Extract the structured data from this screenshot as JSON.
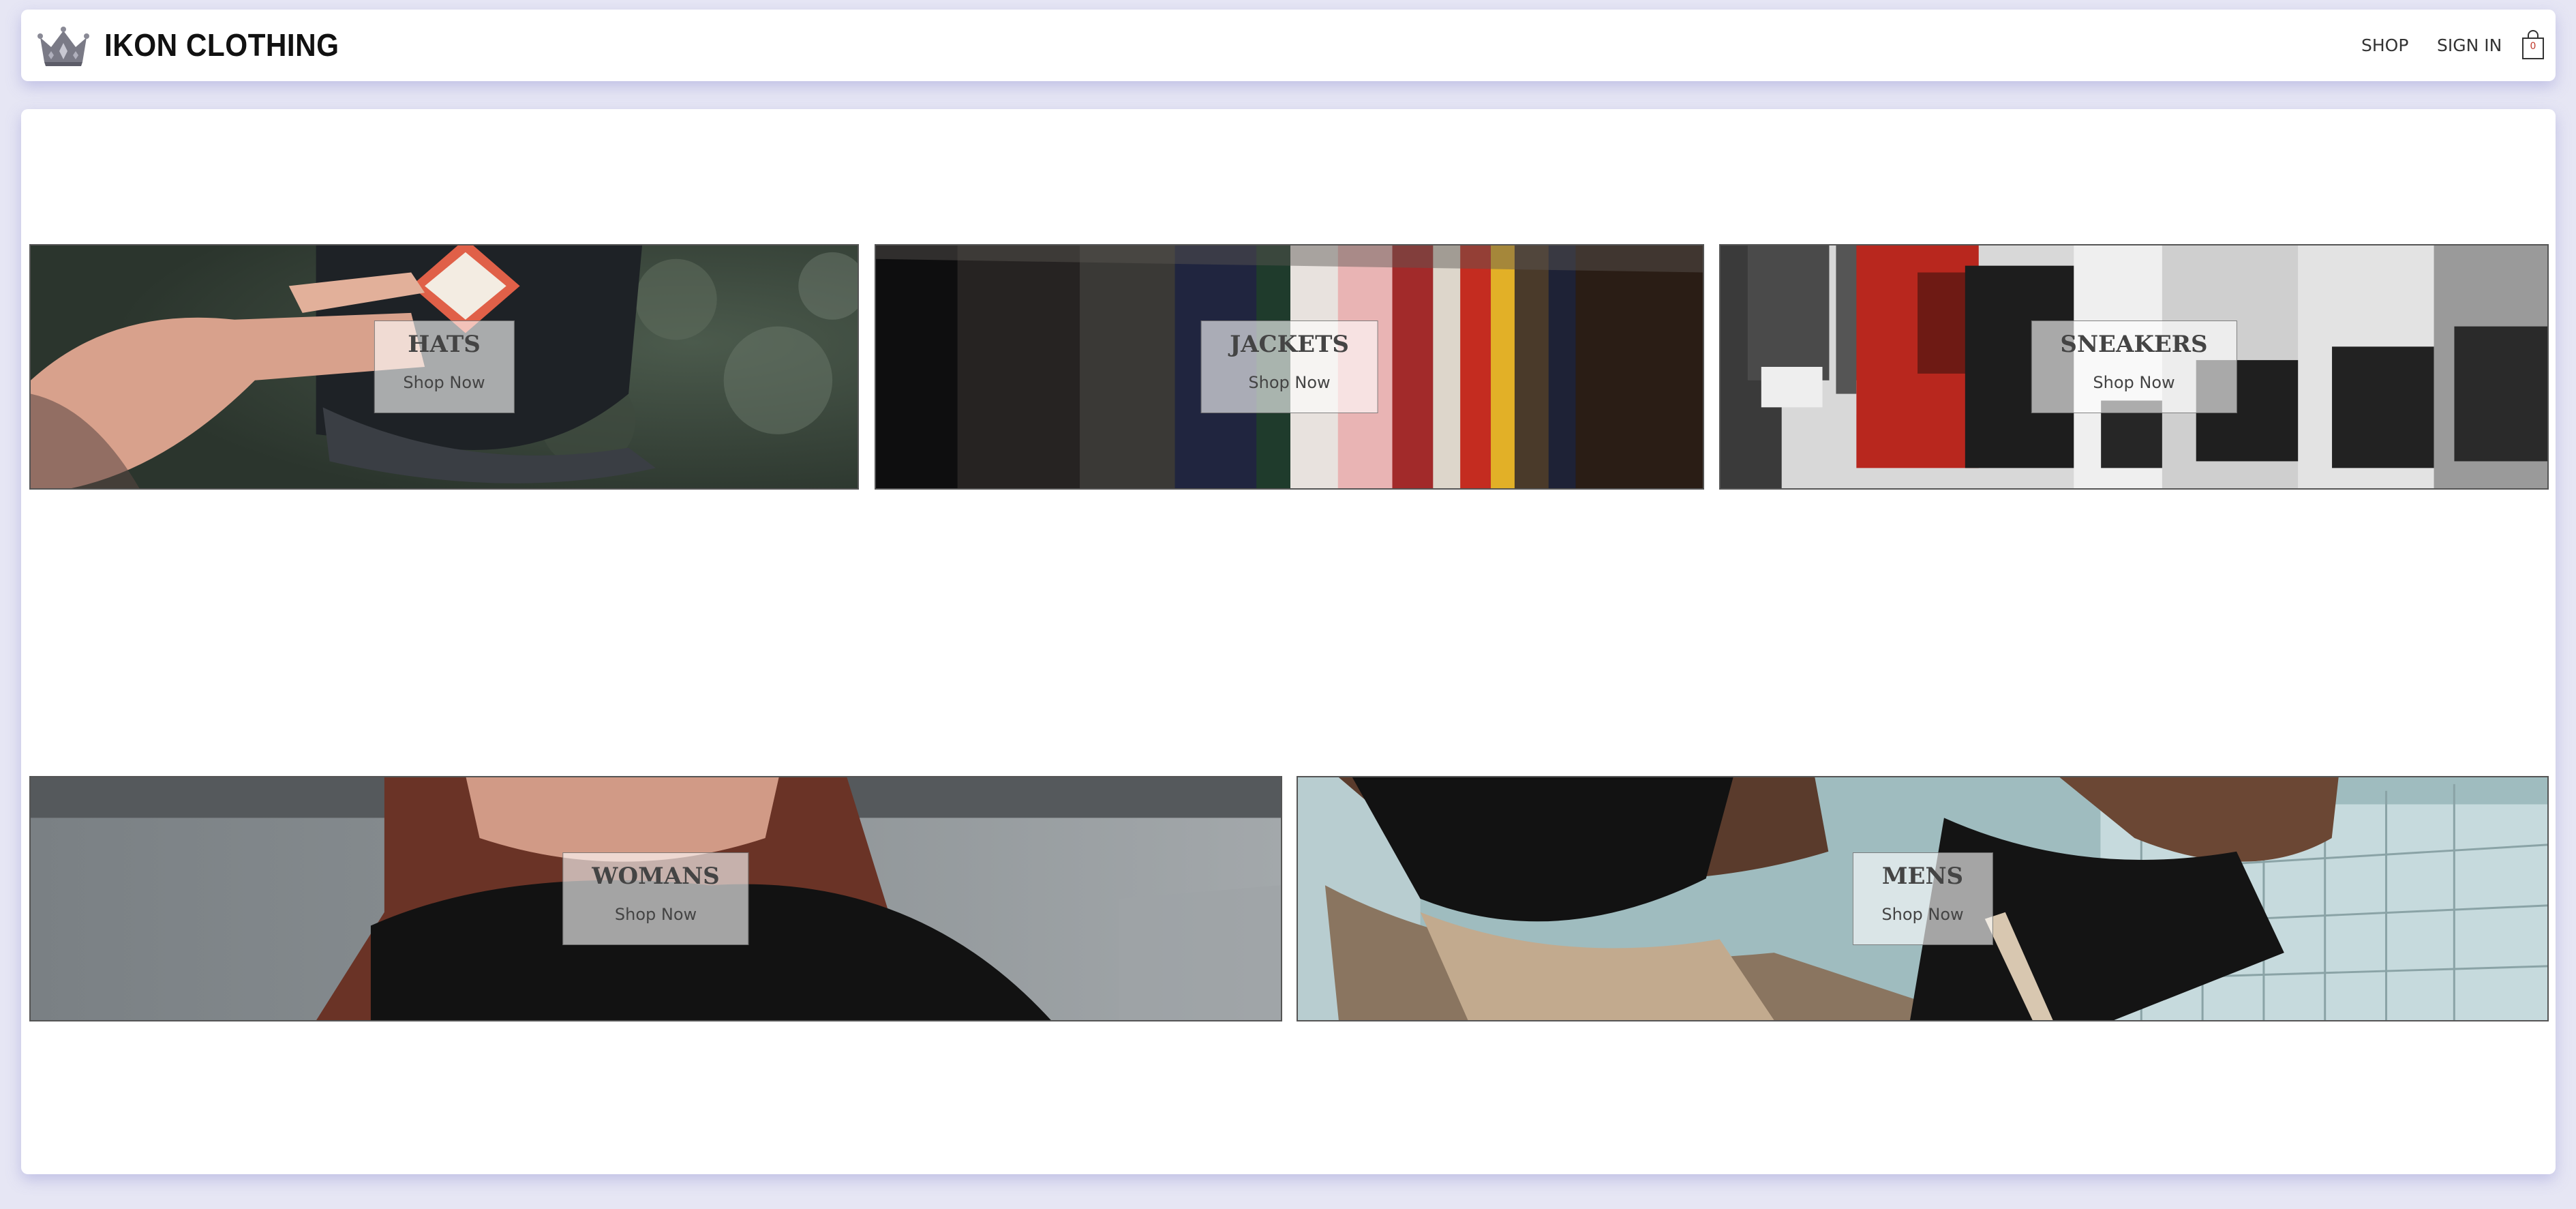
{
  "header": {
    "brand": "IKON CLOTHING",
    "logo_icon": "crown-icon",
    "nav": {
      "shop": "SHOP",
      "sign_in": "SIGN IN"
    },
    "cart": {
      "icon": "shopping-bag-icon",
      "count": "0"
    }
  },
  "directory": {
    "hats": {
      "title": "HATS",
      "cta": "Shop Now"
    },
    "jackets": {
      "title": "JACKETS",
      "cta": "Shop Now"
    },
    "sneakers": {
      "title": "SNEAKERS",
      "cta": "Shop Now"
    },
    "womens": {
      "title": "WOMANS",
      "cta": "Shop Now"
    },
    "mens": {
      "title": "MENS",
      "cta": "Shop Now"
    }
  },
  "colors": {
    "page_background": "#e6e6f4",
    "card_background": "#ffffff",
    "label_text": "#444444",
    "cart_count": "#c0392b"
  }
}
